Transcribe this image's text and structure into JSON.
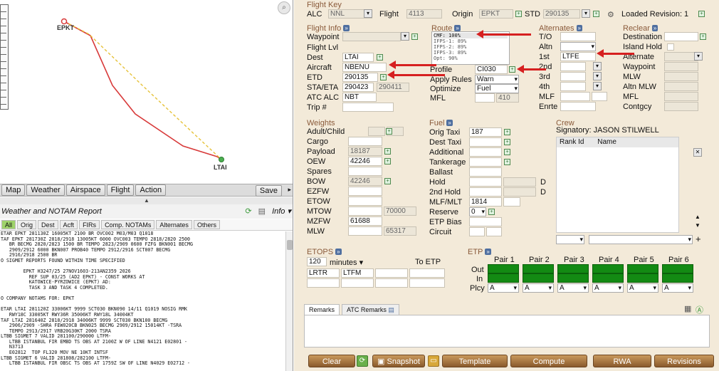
{
  "map": {
    "origin_label": "EPKT",
    "dest_label": "LTAI",
    "tabs": [
      "Map",
      "Weather",
      "Airspace",
      "Flight",
      "Action"
    ],
    "save_label": "Save"
  },
  "weather": {
    "title": "Weather and NOTAM Report",
    "info_label": "Info",
    "tabs": [
      "All",
      "Orig",
      "Dest",
      "Acft",
      "FIRs",
      "Comp. NOTAMs",
      "Alternates",
      "Others"
    ],
    "lines": [
      "ETAR EPKT 281130Z 16005KT 2100 BR OVC002 M03/M03 Q1018",
      "TAF EPKT 281730Z 2818/2918 13005KT 6000 OVC003 TEMPO 2818/2820 2500",
      "   BR BECMG 2820/2823 1500 BR TEMPO 2823/2909 0600 FZFG BKN001 BECMG",
      "   2909/2912 6000 BKN007 PROB40 TEMPO 2912/2916 SCT007 BECMG",
      "   2916/2918 2500 BR",
      "O SIGMET REPORTS FOUND WITHIN TIME SPECIFIED",
      "",
      "        EPKT H3247/25 27NOV1603-213AN2359 2026",
      "          REF SUP 03/25 (AD2 EPKT) - CONST WORKS AT",
      "          KATOWICE-PYRZOWICE (EPKT) AD:",
      "          TASK 3 AND TASK 4 COMPLETED.",
      "",
      "O COMPANY NOTAMS FOR: EPKT",
      "",
      "ETAR LTAI 281120Z 33006KT 9999 SCT030 BKN090 14/11 Q1019 NOSIG RMK",
      "   RWY18C 33005KT RWY36R 35006KT RWY18L 34004KT",
      "TAF LTAI 281640Z 2818/2918 34006KT 9999 SCT030 BKN100 BECMG",
      "   2906/2909 -SHRA FEW020CB BKN025 BECMG 2909/2912 15014KT -TSRA",
      "   TEMPO 2913/2917 VRB20G30KT 2000 TSRA",
      "LTBB SIGMET 7 VALID 281100/290000 LTFM-",
      "   LTBB ISTANBUL FIR EMBD TS OBS AT 2100Z W OF LINE N4121 E02801 -",
      "   N3713",
      "   E02812  TOP FL320 MOV NE 10KT INTSF",
      "LTBB SIGMET 6 VALID 281808/282100 LTFM-",
      "   LTBB ISTANBUL FIR OBSC TS OBS AT 1759Z SW OF LINE N4029 E02712 -"
    ]
  },
  "flight_key": {
    "title": "Flight Key",
    "alc_label": "ALC",
    "alc_value": "NNL",
    "flight_label": "Flight",
    "flight_value": "4113",
    "origin_label": "Origin",
    "origin_value": "EPKT",
    "std_label": "STD",
    "std_value": "290135",
    "loaded_revision": "Loaded Revision: 1"
  },
  "flight_info": {
    "title": "Flight Info",
    "waypoint_label": "Waypoint",
    "flight_lvl_label": "Flight Lvl",
    "dest_label": "Dest",
    "dest_value": "LTAI",
    "aircraft_label": "Aircraft",
    "aircraft_value": "NBENU",
    "etd_label": "ETD",
    "etd_value": "290135",
    "sta_eta_label": "STA/ETA",
    "sta_value": "290423",
    "eta_value": "290411",
    "atc_alc_label": "ATC ALC",
    "atc_alc_value": "NBT",
    "trip_label": "Trip #"
  },
  "route": {
    "title": "Route",
    "options": [
      "CMF: 100%",
      "IFPS-1: 89%",
      "IFPS-2: 89%",
      "IFPS-3: 89%",
      "Opt: 90%"
    ],
    "profile_label": "Profile",
    "profile_value": "CI030",
    "apply_rules_label": "Apply Rules",
    "apply_rules_value": "Warn",
    "optimize_label": "Optimize",
    "optimize_value": "Fuel",
    "mfl_label": "MFL",
    "mfl_value": "410"
  },
  "alternates": {
    "title": "Alternates",
    "to_label": "T/O",
    "altn_label": "Altn",
    "first_label": "1st",
    "first_value": "LTFE",
    "second_label": "2nd",
    "third_label": "3rd",
    "fourth_label": "4th",
    "mlf_label": "MLF",
    "enrte_label": "Enrte"
  },
  "reclear": {
    "title": "Reclear",
    "destination_label": "Destination",
    "island_hold_label": "Island Hold",
    "alternate_label": "Alternate",
    "waypoint_label": "Waypoint",
    "mlw_label": "MLW",
    "altn_mlw_label": "Altn MLW",
    "mfl_label": "MFL",
    "contgcy_label": "Contgcy"
  },
  "weights": {
    "title": "Weights",
    "adult_child_label": "Adult/Child",
    "cargo_label": "Cargo",
    "payload_label": "Payload",
    "payload_value": "18187",
    "oew_label": "OEW",
    "oew_value": "42246",
    "spares_label": "Spares",
    "bow_label": "BOW",
    "bow_value": "42246",
    "ezfw_label": "EZFW",
    "etow_label": "ETOW",
    "mtow_label": "MTOW",
    "mtow_value": "70000",
    "mzfw_label": "MZFW",
    "mzfw_value": "61688",
    "mlw_label": "MLW",
    "mlw_value": "65317"
  },
  "fuel": {
    "title": "Fuel",
    "orig_taxi_label": "Orig Taxi",
    "orig_taxi_value": "187",
    "dest_taxi_label": "Dest Taxi",
    "additional_label": "Additional",
    "tankerage_label": "Tankerage",
    "ballast_label": "Ballast",
    "hold_label": "Hold",
    "hold_unit": "D",
    "second_hold_label": "2nd Hold",
    "second_hold_unit": "D",
    "mlf_mlt_label": "MLF/MLT",
    "mlf_mlt_value": "1814",
    "reserve_label": "Reserve",
    "reserve_value": "0",
    "etp_bias_label": "ETP Bias",
    "circuit_label": "Circuit"
  },
  "crew": {
    "title": "Crew",
    "signatory": "Signatory: JASON STILWELL",
    "col_rank": "Rank Id",
    "col_name": "Name"
  },
  "etops": {
    "title": "ETOPS",
    "minutes_value": "120",
    "minutes_label": "minutes",
    "to_etp_label": "To ETP",
    "airport_1": "LRTR",
    "airport_2": "LTFM"
  },
  "etp": {
    "title": "ETP",
    "pairs": [
      "Pair 1",
      "Pair 2",
      "Pair 3",
      "Pair 4",
      "Pair 5",
      "Pair 6"
    ],
    "out_label": "Out",
    "in_label": "In",
    "plcy_label": "Plcy",
    "plcy_value": "A"
  },
  "remarks": {
    "tab_remarks": "Remarks",
    "tab_atc": "ATC Remarks"
  },
  "buttons": {
    "clear": "Clear",
    "snapshot": "Snapshot",
    "template": "Template",
    "compute": "Compute",
    "rwa": "RWA",
    "revisions": "Revisions"
  },
  "colors": {
    "panel_bg": "#f3ead9",
    "section_title": "#8a5a3a",
    "annotation_red": "#d62020",
    "etp_green": "#138a13",
    "button_brown": "#a8743f"
  }
}
